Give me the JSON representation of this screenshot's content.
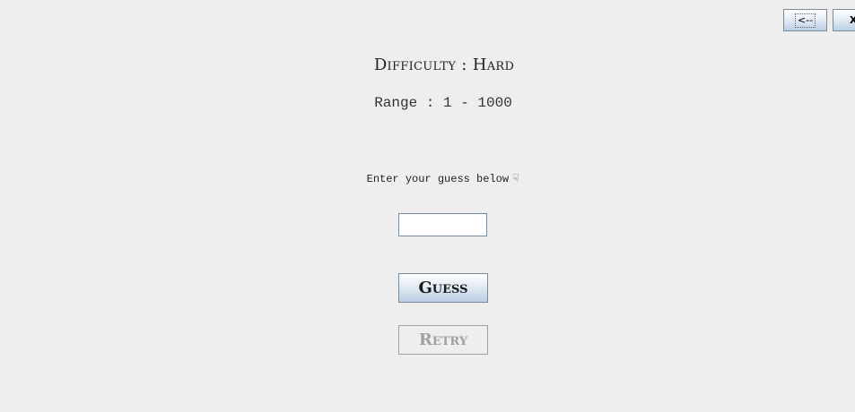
{
  "toolbar": {
    "back_label": "<--",
    "close_label": "X"
  },
  "game": {
    "difficulty_text": "Difficulty : Hard",
    "range_text": "Range : 1 - 1000",
    "prompt_text": "Enter your guess below",
    "prompt_icon": "pointing-hand-icon",
    "guess_value": "",
    "guess_label": "Guess",
    "retry_label": "Retry",
    "retry_enabled": false
  }
}
